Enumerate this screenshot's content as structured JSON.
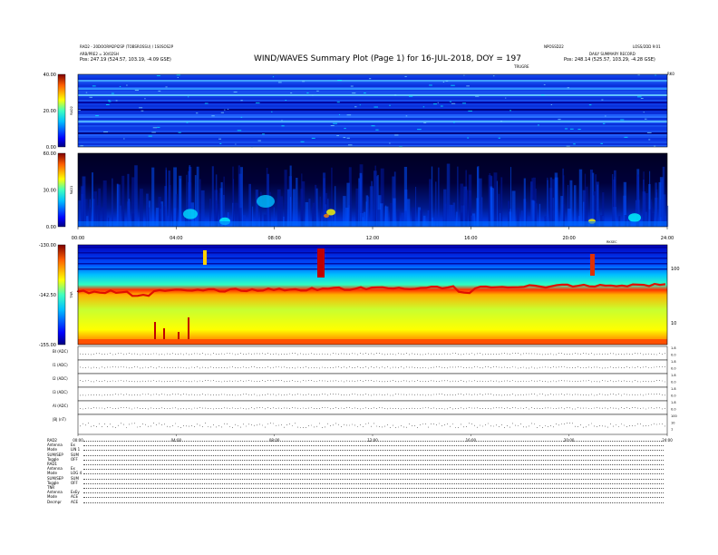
{
  "header": {
    "line1_left": "RAD2 - 20DOORM2PI2SP (TOBSROSSU) / 1S0SOS2P",
    "line2_left": "ARB/PRE2 = 30/02SH",
    "line3_left": "Pos: 247.19 (524.57, 103.19, -4.09 GSE)",
    "title": "WIND/WAVES Summary Plot (Page 1) for 16-JUL-2018, DOY = 197",
    "top_center": "NPOSSD22",
    "top_right": "LOSS/2DD 9:01",
    "line2_right": "DAILY SUMMARY RECORD",
    "line3_right": "Pos: 248.14 (525.57, 103.29, -4.28 GSE)",
    "sub_center": "TRUGRE",
    "sub_right": "RK0"
  },
  "chart_data": [
    {
      "type": "heatmap",
      "name": "RAD2",
      "ylabel": "RAD2",
      "yticks": [
        "40.00",
        "20.00",
        "0.00"
      ],
      "ylim": [
        0,
        40
      ],
      "colormap": [
        "#00007f",
        "#0000ff",
        "#007fff",
        "#00ffff",
        "#7fff7f",
        "#ffff00",
        "#ff7f00",
        "#ff0000",
        "#7f0000"
      ]
    },
    {
      "type": "heatmap",
      "name": "RAD1",
      "ylabel": "RAD1",
      "yticks": [
        "60.00",
        "30.00",
        "0.00"
      ],
      "ylim": [
        0,
        60
      ],
      "xticks": [
        "00:00",
        "04:00",
        "08:00",
        "12:00",
        "16:00",
        "20:00",
        "24:00"
      ],
      "xlabel_right": "RKSEC"
    },
    {
      "type": "heatmap",
      "name": "TNR",
      "ylabel": "TNR",
      "yticks": [
        "-130.00",
        "-142.50",
        "-155.00"
      ],
      "ylim": [
        -155,
        -130
      ],
      "right_ticks": [
        "100",
        "10"
      ]
    },
    {
      "type": "line",
      "name": "status_traces",
      "rows": [
        {
          "label": "BI (ADC)",
          "right": [
            "1.8",
            "0.0"
          ]
        },
        {
          "label": "I1 (ADC)",
          "right": [
            "1.8",
            "0.0"
          ]
        },
        {
          "label": "I2 (ADC)",
          "right": [
            "1.8",
            "0.0"
          ]
        },
        {
          "label": "I3 (ADC)",
          "right": [
            "1.8",
            "0.0"
          ]
        },
        {
          "label": "AI (ADC)",
          "right": [
            "1.8",
            "0.0"
          ]
        },
        {
          "label": "|B| (nT)",
          "right": [
            "100",
            "10",
            "1"
          ]
        }
      ],
      "xticks": [
        "00:00",
        "04:00",
        "08:00",
        "12:00",
        "16:00",
        "20:00",
        "24:00"
      ]
    }
  ],
  "footer": {
    "rows": [
      {
        "label": "RAD2",
        "value": ""
      },
      {
        "label": "Antenna",
        "value": "Ex"
      },
      {
        "label": "Mode",
        "value": "LIN 1"
      },
      {
        "label": "SUM/SEP",
        "value": "SUM"
      },
      {
        "label": "Toggle",
        "value": "OFF"
      },
      {
        "label": "RAD1",
        "value": ""
      },
      {
        "label": "Antenna",
        "value": "Ex"
      },
      {
        "label": "Mode",
        "value": "LOG 4"
      },
      {
        "label": "SUM/SEP",
        "value": "SUM"
      },
      {
        "label": "Toggle",
        "value": "OFF"
      },
      {
        "label": "TNR",
        "value": ""
      },
      {
        "label": "Antenna",
        "value": "ExEy"
      },
      {
        "label": "Mode",
        "value": "ACE"
      },
      {
        "label": "Decmpr",
        "value": "ACE"
      }
    ]
  }
}
